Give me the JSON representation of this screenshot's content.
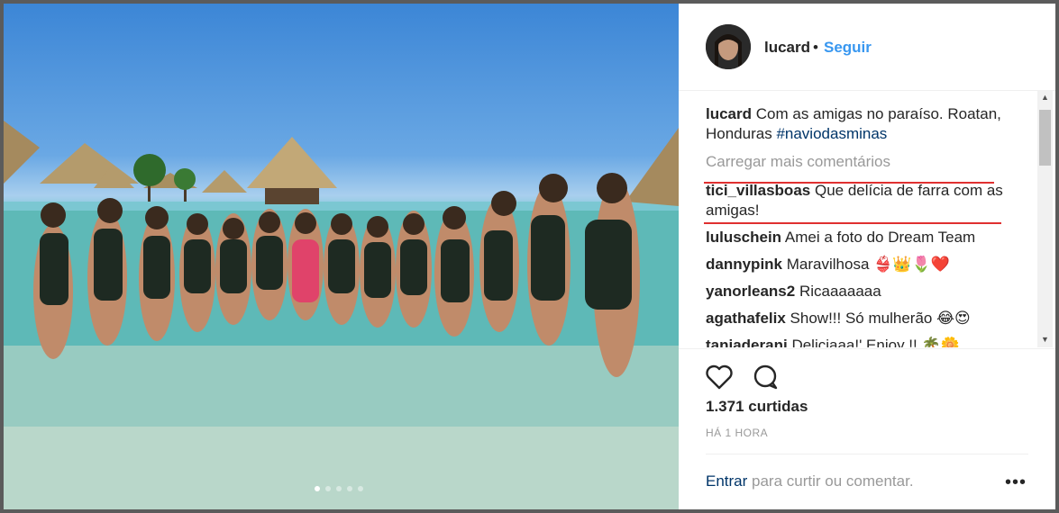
{
  "header": {
    "username": "lucard",
    "bullet": "•",
    "follow_label": "Seguir"
  },
  "caption": {
    "username": "lucard",
    "text": "Com as amigas no paraíso. Roatan, Honduras ",
    "hashtag": "#naviodasminas"
  },
  "load_more_label": "Carregar mais comentários",
  "comments": [
    {
      "user": "tici_villasboas",
      "text": "Que delícia de farra com as amigas!"
    },
    {
      "user": "luluschein",
      "text": "Amei a foto do Dream Team"
    },
    {
      "user": "dannypink",
      "text": "Maravilhosa 👙👑🌷❤️"
    },
    {
      "user": "yanorleans2",
      "text": "Ricaaaaaaa"
    },
    {
      "user": "agathafelix",
      "text": "Show!!! Só mulherão 😂😍"
    },
    {
      "user": "taniaderani",
      "text": "Deliciaaa!' Enjoy !! 🌴🌼"
    }
  ],
  "likes": "1.371 curtidas",
  "timestamp": "HÁ 1 HORA",
  "login": {
    "link": "Entrar",
    "rest": " para curtir ou comentar."
  },
  "more_label": "•••",
  "carousel": {
    "count": 5,
    "active_index": 0
  },
  "colors": {
    "accent": "#3897f0",
    "hashtag": "#003569",
    "annotation": "#e03030"
  }
}
